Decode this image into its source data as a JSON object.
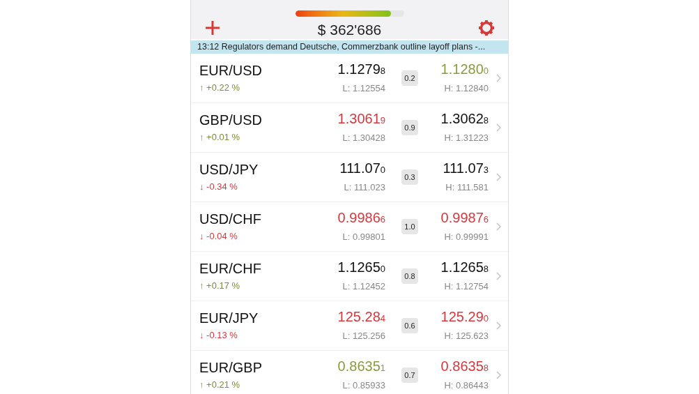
{
  "header": {
    "gauge": {
      "level": 0.88
    },
    "balance": "$ 362'686"
  },
  "news_ticker": "13:12 Regulators demand Deutsche, Commerzbank outline layoff plans -...",
  "quotes": [
    {
      "pair": "EUR/USD",
      "change": {
        "text": "↑ +0.22 %",
        "color": "#7e8c35"
      },
      "bid": {
        "value": "1.1279",
        "last": "8",
        "color": "#111111"
      },
      "low": "L: 1.12554",
      "spread": "0.2",
      "ask": {
        "value": "1.1280",
        "last": "0",
        "color": "#8c9a3c"
      },
      "high": "H: 1.12840"
    },
    {
      "pair": "GBP/USD",
      "change": {
        "text": "↑ +0.01 %",
        "color": "#7e8c35"
      },
      "bid": {
        "value": "1.3061",
        "last": "9",
        "color": "#d8383d"
      },
      "low": "L: 1.30428",
      "spread": "0.9",
      "ask": {
        "value": "1.3062",
        "last": "8",
        "color": "#111111"
      },
      "high": "H: 1.31223"
    },
    {
      "pair": "USD/JPY",
      "change": {
        "text": "↓ -0.34 %",
        "color": "#d8383d"
      },
      "bid": {
        "value": "111.07",
        "last": "0",
        "color": "#111111"
      },
      "low": "L: 111.023",
      "spread": "0.3",
      "ask": {
        "value": "111.07",
        "last": "3",
        "color": "#111111"
      },
      "high": "H: 111.581"
    },
    {
      "pair": "USD/CHF",
      "change": {
        "text": "↓ -0.04 %",
        "color": "#d8383d"
      },
      "bid": {
        "value": "0.9986",
        "last": "6",
        "color": "#d8383d"
      },
      "low": "L: 0.99801",
      "spread": "1.0",
      "ask": {
        "value": "0.9987",
        "last": "6",
        "color": "#d8383d"
      },
      "high": "H: 0.99991"
    },
    {
      "pair": "EUR/CHF",
      "change": {
        "text": "↑ +0.17 %",
        "color": "#7e8c35"
      },
      "bid": {
        "value": "1.1265",
        "last": "0",
        "color": "#111111"
      },
      "low": "L: 1.12452",
      "spread": "0.8",
      "ask": {
        "value": "1.1265",
        "last": "8",
        "color": "#111111"
      },
      "high": "H: 1.12754"
    },
    {
      "pair": "EUR/JPY",
      "change": {
        "text": "↓ -0.13 %",
        "color": "#d8383d"
      },
      "bid": {
        "value": "125.28",
        "last": "4",
        "color": "#d8383d"
      },
      "low": "L: 125.256",
      "spread": "0.6",
      "ask": {
        "value": "125.29",
        "last": "0",
        "color": "#d8383d"
      },
      "high": "H: 125.623"
    },
    {
      "pair": "EUR/GBP",
      "change": {
        "text": "↑ +0.21 %",
        "color": "#7e8c35"
      },
      "bid": {
        "value": "0.8635",
        "last": "1",
        "color": "#8c9a3c"
      },
      "low": "L: 0.85933",
      "spread": "0.7",
      "ask": {
        "value": "0.8635",
        "last": "8",
        "color": "#d8383d"
      },
      "high": "H: 0.86443"
    }
  ]
}
